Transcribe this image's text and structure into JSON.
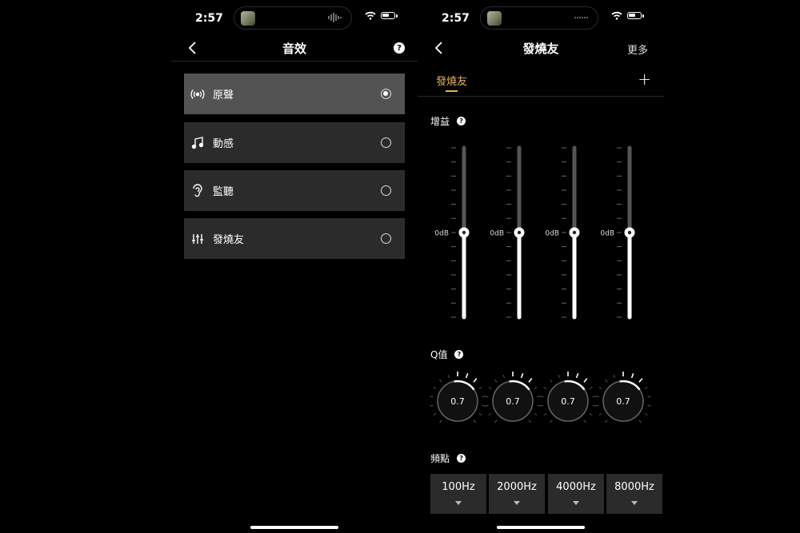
{
  "left": {
    "status": {
      "time": "2:57"
    },
    "nav": {
      "title": "音效"
    },
    "items": [
      {
        "label": "原聲",
        "icon": "broadcast-icon",
        "selected": true
      },
      {
        "label": "動感",
        "icon": "music-note-icon",
        "selected": false
      },
      {
        "label": "監聽",
        "icon": "ear-icon",
        "selected": false
      },
      {
        "label": "發燒友",
        "icon": "equalizer-sliders-icon",
        "selected": false
      }
    ]
  },
  "right": {
    "status": {
      "time": "2:57"
    },
    "nav": {
      "title": "發燒友",
      "more": "更多"
    },
    "tab": {
      "active": "發燒友",
      "add": "+"
    },
    "gain": {
      "label": "增益",
      "bands": [
        {
          "value": "0dB"
        },
        {
          "value": "0dB"
        },
        {
          "value": "0dB"
        },
        {
          "value": "0dB"
        }
      ]
    },
    "q": {
      "label": "Q值",
      "knobs": [
        {
          "value": "0.7"
        },
        {
          "value": "0.7"
        },
        {
          "value": "0.7"
        },
        {
          "value": "0.7"
        }
      ]
    },
    "freq": {
      "label": "頻點",
      "options": [
        "100Hz",
        "2000Hz",
        "4000Hz",
        "8000Hz"
      ]
    }
  },
  "colors": {
    "accent": "#e8b35a",
    "panel": "#2b2b2b",
    "selected": "#535353",
    "background": "#000000"
  }
}
